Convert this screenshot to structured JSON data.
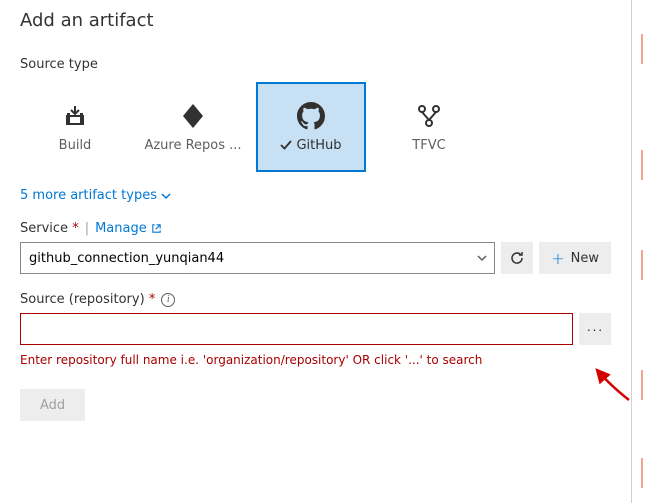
{
  "title": "Add an artifact",
  "sourceType": {
    "label": "Source type",
    "tiles": [
      {
        "id": "build",
        "label": "Build"
      },
      {
        "id": "azure-repos",
        "label": "Azure Repos ..."
      },
      {
        "id": "github",
        "label": "GitHub",
        "selected": true
      },
      {
        "id": "tfvc",
        "label": "TFVC"
      }
    ],
    "moreLink": "5 more artifact types"
  },
  "service": {
    "label": "Service",
    "manageLink": "Manage",
    "value": "github_connection_yunqian44",
    "newLabel": "New"
  },
  "repository": {
    "label": "Source (repository)",
    "value": "",
    "error": "Enter repository full name i.e. 'organization/repository' OR click '...' to search"
  },
  "addButton": "Add"
}
